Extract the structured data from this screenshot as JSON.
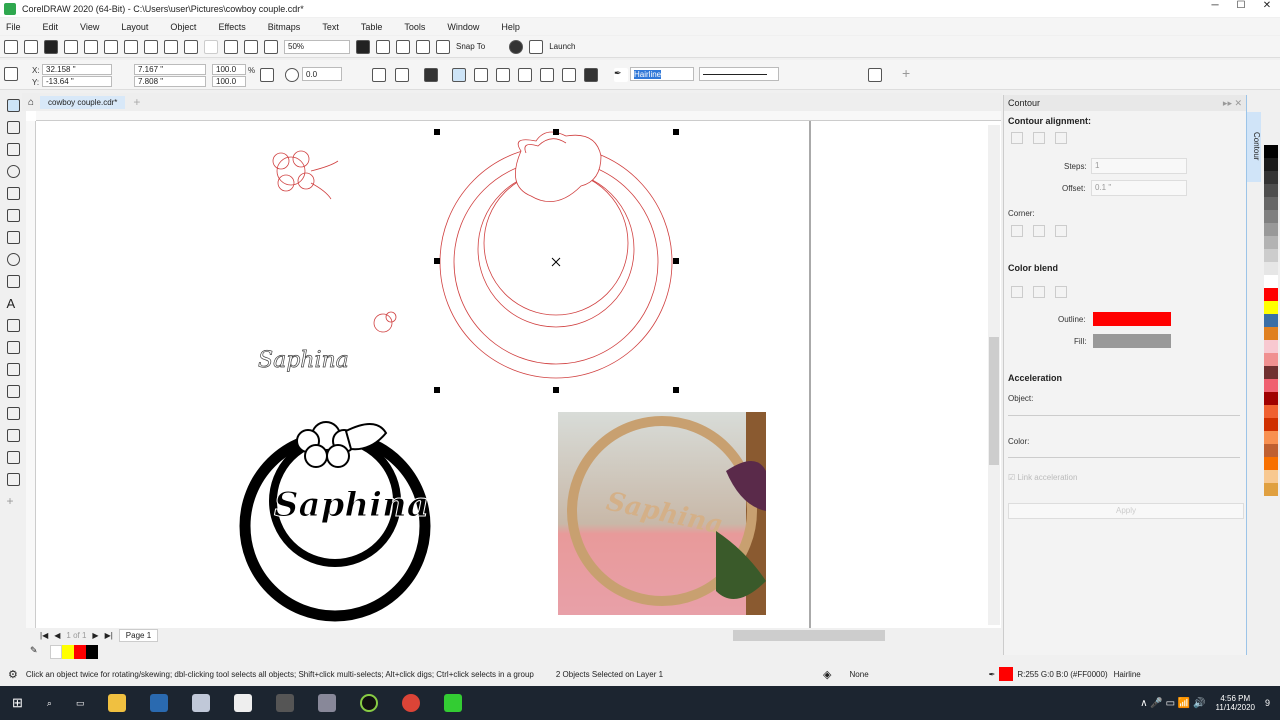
{
  "app": {
    "title": "CorelDRAW 2020 (64-Bit) - C:\\Users\\user\\Pictures\\cowboy couple.cdr*"
  },
  "menu": [
    "File",
    "Edit",
    "View",
    "Layout",
    "Object",
    "Effects",
    "Bitmaps",
    "Text",
    "Table",
    "Tools",
    "Window",
    "Help"
  ],
  "toolbar": {
    "zoom": "50%",
    "snap_to": "Snap To",
    "launch": "Launch"
  },
  "propbar": {
    "x": "32.158 \"",
    "y": "-13.64 \"",
    "width": "7.167 \"",
    "height": "7.808 \"",
    "scale_x": "100.0",
    "scale_y": "100.0",
    "pct": "%",
    "angle": "0.0",
    "outline_width": "Hairline"
  },
  "tab": {
    "label": "cowboy couple.cdr*"
  },
  "pagenav": {
    "counter": "1 of 1",
    "page": "Page 1"
  },
  "docker": {
    "title": "Contour",
    "alignment": "Contour alignment:",
    "steps_label": "Steps:",
    "steps": "1",
    "offset_label": "Offset:",
    "offset": "0.1 \"",
    "corner": "Corner:",
    "color_blend": "Color blend",
    "outline_label": "Outline:",
    "fill_label": "Fill:",
    "acceleration": "Acceleration",
    "object": "Object:",
    "color": "Color:",
    "link": "Link acceleration",
    "apply": "Apply",
    "side_tab": "Contour",
    "outline_color": "#ff0000",
    "fill_color": "#999999"
  },
  "canvas": {
    "text1": "Saphina",
    "text2": "Saphina",
    "text3": "Saphina"
  },
  "status": {
    "hint": "Click an object twice for rotating/skewing; dbl-clicking tool selects all objects; Shift+click multi-selects; Alt+click digs; Ctrl+click selects in a group",
    "selection": "2 Objects Selected on Layer 1",
    "fill": "None",
    "outline": "R:255 G:0 B:0 (#FF0000)",
    "outline_width": "Hairline"
  },
  "taskbar": {
    "time": "4:56 PM",
    "date": "11/14/2020",
    "notifications": "9"
  },
  "palette": [
    "#000000",
    "#1a1a1a",
    "#333333",
    "#4d4d4d",
    "#666666",
    "#808080",
    "#999999",
    "#b3b3b3",
    "#cccccc",
    "#e6e6e6",
    "#ffffff",
    "#ff0000",
    "#ffff00",
    "#3a6ea5",
    "#e08020",
    "#f8c8d0",
    "#f09090",
    "#703030",
    "#f06070",
    "#a00000",
    "#f06030",
    "#d03000",
    "#f89050",
    "#c06030",
    "#f87000",
    "#f8c890",
    "#e0a040"
  ],
  "doc_palette": [
    "#ffff00",
    "#ff0000",
    "#000000"
  ]
}
